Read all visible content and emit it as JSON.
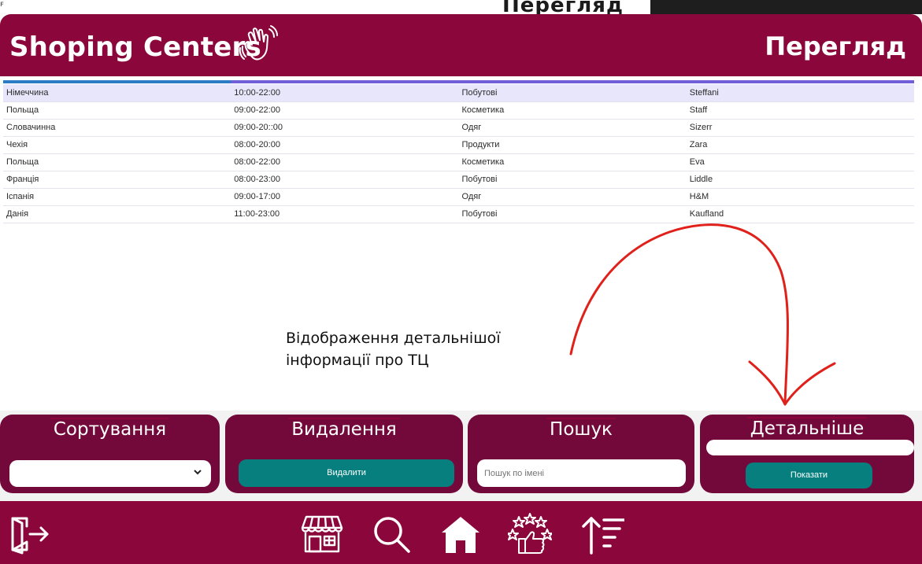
{
  "window": {
    "background_title": "Перегляд"
  },
  "header": {
    "title": "Shoping Centers",
    "page_title": "Перегляд",
    "wave_icon": "waving-hand-icon"
  },
  "table": {
    "rows": [
      [
        "Німеччина",
        "10:00-22:00",
        "Побутові",
        "Steffani"
      ],
      [
        "Польща",
        "09:00-22:00",
        "Косметика",
        "Staff"
      ],
      [
        "Словачинна",
        "09:00-20::00",
        "Одяг",
        "Sizerr"
      ],
      [
        "Чехія",
        "08:00-20:00",
        "Продукти",
        "Zara"
      ],
      [
        "Польща",
        "08:00-22:00",
        "Косметика",
        "Eva"
      ],
      [
        "Франція",
        "08:00-23:00",
        "Побутові",
        "Liddle"
      ],
      [
        "Іспанія",
        "09:00-17:00",
        "Одяг",
        "H&M"
      ],
      [
        "Данія",
        "11:00-23:00",
        "Побутові",
        "Kaufland"
      ]
    ]
  },
  "annotation": {
    "line1": "Відображення детальнішої",
    "line2": "інформації про ТЦ"
  },
  "panels": {
    "sort": {
      "title": "Сортування",
      "selected": ""
    },
    "delete": {
      "title": "Видалення",
      "button": "Видалити"
    },
    "search": {
      "title": "Пошук",
      "placeholder": "Пошук по імені"
    },
    "details": {
      "title": "Детальніше",
      "value": "",
      "button": "Показати"
    }
  },
  "nav": {
    "icons": [
      "exit-icon",
      "store-icon",
      "search-icon",
      "home-icon",
      "rating-icon",
      "sort-icon"
    ]
  },
  "colors": {
    "brand": "#8b063b",
    "panel": "#72093a",
    "button": "#077f7f",
    "annotation_arrow": "#e0211b"
  }
}
